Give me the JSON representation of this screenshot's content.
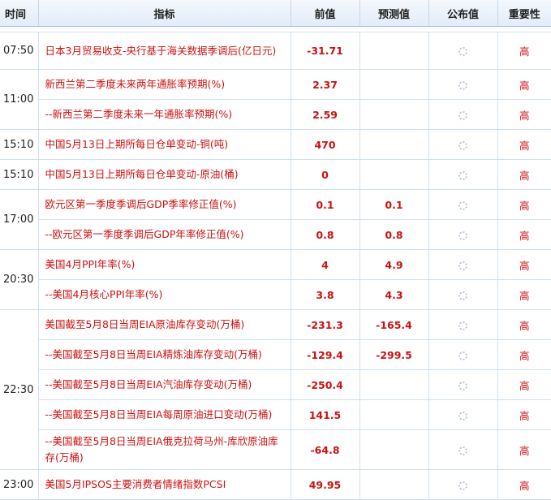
{
  "headers": {
    "time": "时间",
    "indicator": "指标",
    "previous": "前值",
    "forecast": "预测值",
    "actual": "公布值",
    "importance": "重要性"
  },
  "rows": [
    {
      "time": "07:50",
      "indicator": "日本3月贸易收支-央行基于海关数据季调后(亿日元)",
      "previous": "-31.71",
      "forecast": "",
      "importance": "高"
    },
    {
      "time": "11:00",
      "indicator": "新西兰第二季度未来两年通胀率预期(%)",
      "previous": "2.37",
      "forecast": "",
      "importance": "高"
    },
    {
      "time": "",
      "indicator": "--新西兰第二季度未来一年通胀率预期(%)",
      "previous": "2.59",
      "forecast": "",
      "importance": "高"
    },
    {
      "time": "15:10",
      "indicator": "中国5月13日上期所每日仓单变动-铜(吨)",
      "previous": "470",
      "forecast": "",
      "importance": "高"
    },
    {
      "time": "15:10",
      "indicator": "中国5月13日上期所每日仓单变动-原油(桶)",
      "previous": "0",
      "forecast": "",
      "importance": "高"
    },
    {
      "time": "17:00",
      "indicator": "欧元区第一季度季调后GDP季率修正值(%)",
      "previous": "0.1",
      "forecast": "0.1",
      "importance": "高"
    },
    {
      "time": "",
      "indicator": "--欧元区第一季度季调后GDP年率修正值(%)",
      "previous": "0.8",
      "forecast": "0.8",
      "importance": "高"
    },
    {
      "time": "20:30",
      "indicator": "美国4月PPI年率(%)",
      "previous": "4",
      "forecast": "4.9",
      "importance": "高"
    },
    {
      "time": "",
      "indicator": "--美国4月核心PPI年率(%)",
      "previous": "3.8",
      "forecast": "4.3",
      "importance": "高"
    },
    {
      "time": "22:30",
      "indicator": "美国截至5月8日当周EIA原油库存变动(万桶)",
      "previous": "-231.3",
      "forecast": "-165.4",
      "importance": "高"
    },
    {
      "time": "",
      "indicator": "--美国截至5月8日当周EIA精炼油库存变动(万桶)",
      "previous": "-129.4",
      "forecast": "-299.5",
      "importance": "高"
    },
    {
      "time": "",
      "indicator": "--美国截至5月8日当周EIA汽油库存变动(万桶)",
      "previous": "-250.4",
      "forecast": "",
      "importance": "高"
    },
    {
      "time": "",
      "indicator": "--美国截至5月8日当周EIA每周原油进口变动(万桶)",
      "previous": "141.5",
      "forecast": "",
      "importance": "高"
    },
    {
      "time": "",
      "indicator": "--美国截至5月8日当周EIA俄克拉荷马州-库欣原油库存(万桶)",
      "previous": "-64.8",
      "forecast": "",
      "importance": "高"
    },
    {
      "time": "23:00",
      "indicator": "美国5月IPSOS主要消费者情绪指数PCSI",
      "previous": "49.95",
      "forecast": "",
      "importance": "高"
    }
  ]
}
